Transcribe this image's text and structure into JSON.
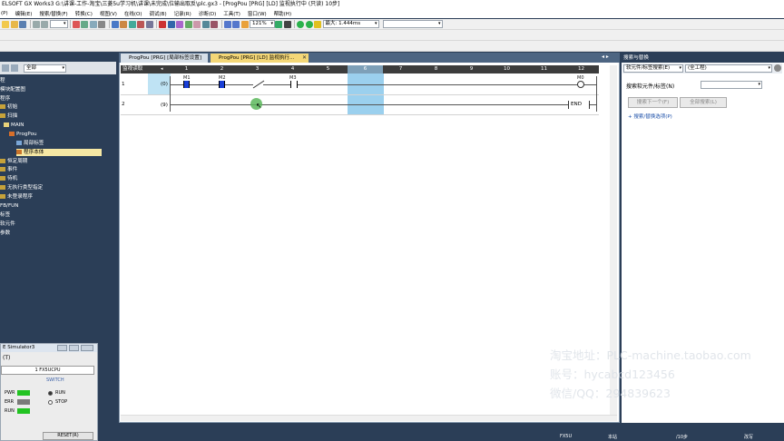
{
  "window": {
    "title": "ELSOFT GX Works3 G:\\讲课-工作-淘宝\\三菱5u学习机\\讲课\\未完成\\位输出取反\\plc.gx3 - [ProgPou [PRG] [LD] 监视执行中 (只读) 10步]"
  },
  "menu": [
    "(P)",
    "编辑(E)",
    "搜索/替换(F)",
    "转换(C)",
    "视图(V)",
    "在线(O)",
    "调试(B)",
    "记录(R)",
    "诊断(D)",
    "工具(T)",
    "窗口(W)",
    "帮助(H)"
  ],
  "toolbar": {
    "zoom": "121%",
    "scan_time": "最大: 1.444ms"
  },
  "nav": {
    "filter": "全部",
    "items": [
      {
        "label": "程"
      },
      {
        "label": "模块配置图"
      },
      {
        "label": "程序"
      },
      {
        "label": "初始"
      },
      {
        "label": "扫描"
      },
      {
        "label": "MAIN"
      },
      {
        "label": "ProgPou"
      },
      {
        "label": "局部标签"
      },
      {
        "label": "程序本体"
      },
      {
        "label": "恒定周期"
      },
      {
        "label": "事件"
      },
      {
        "label": "待机"
      },
      {
        "label": "无执行类型指定"
      },
      {
        "label": "未登录程序"
      },
      {
        "label": "FB/FUN"
      },
      {
        "label": "标签"
      },
      {
        "label": "软元件"
      },
      {
        "label": "参数"
      }
    ]
  },
  "simulator": {
    "title": "E Simulator3",
    "menu": "(T)",
    "cpu": "1 FX5UCPU",
    "switch_label": "SWITCH",
    "leds": [
      "PWR",
      "ERR",
      "RUN"
    ],
    "options": [
      "RUN",
      "STOP"
    ],
    "reset": "RESET(R)"
  },
  "editor": {
    "tabs": [
      {
        "label": "ProgPou [PRG] [局部标签设置]"
      },
      {
        "label": "ProgPou [PRG] [LD] 监视执行..."
      }
    ],
    "read_mode": "监视读取",
    "columns": [
      "1",
      "2",
      "3",
      "4",
      "5",
      "6",
      "7",
      "8",
      "9",
      "10",
      "11",
      "12"
    ],
    "rows": [
      {
        "num": "1",
        "step": "(0)",
        "contacts": [
          "M1",
          "M2",
          "",
          "M3"
        ],
        "coil": "M0"
      },
      {
        "num": "2",
        "step": "(9)",
        "instruction": "END"
      }
    ]
  },
  "search_panel": {
    "title": "搜索与替换",
    "mode": "软元件/标签搜索(E)",
    "scope": "(全工程)",
    "field_label": "搜索软元件/标签(N)",
    "next": "搜索下一个(F)",
    "all": "全部搜索(L)",
    "options": "+ 搜索/替换选项(P)"
  },
  "status": {
    "model": "FX5U",
    "host": "本站",
    "steps": "/10步",
    "mode": "改写"
  },
  "watermark": [
    "淘宝地址：PLC-machine.taobao.com",
    "账号：hycabcd123456",
    "微信/QQ：294839623"
  ],
  "colors": {
    "nav_bg": "#2b3e57",
    "selected_col": "#9bd0ee",
    "monitor_on": "#1a3fd6",
    "cursor": "#5cb85c"
  }
}
